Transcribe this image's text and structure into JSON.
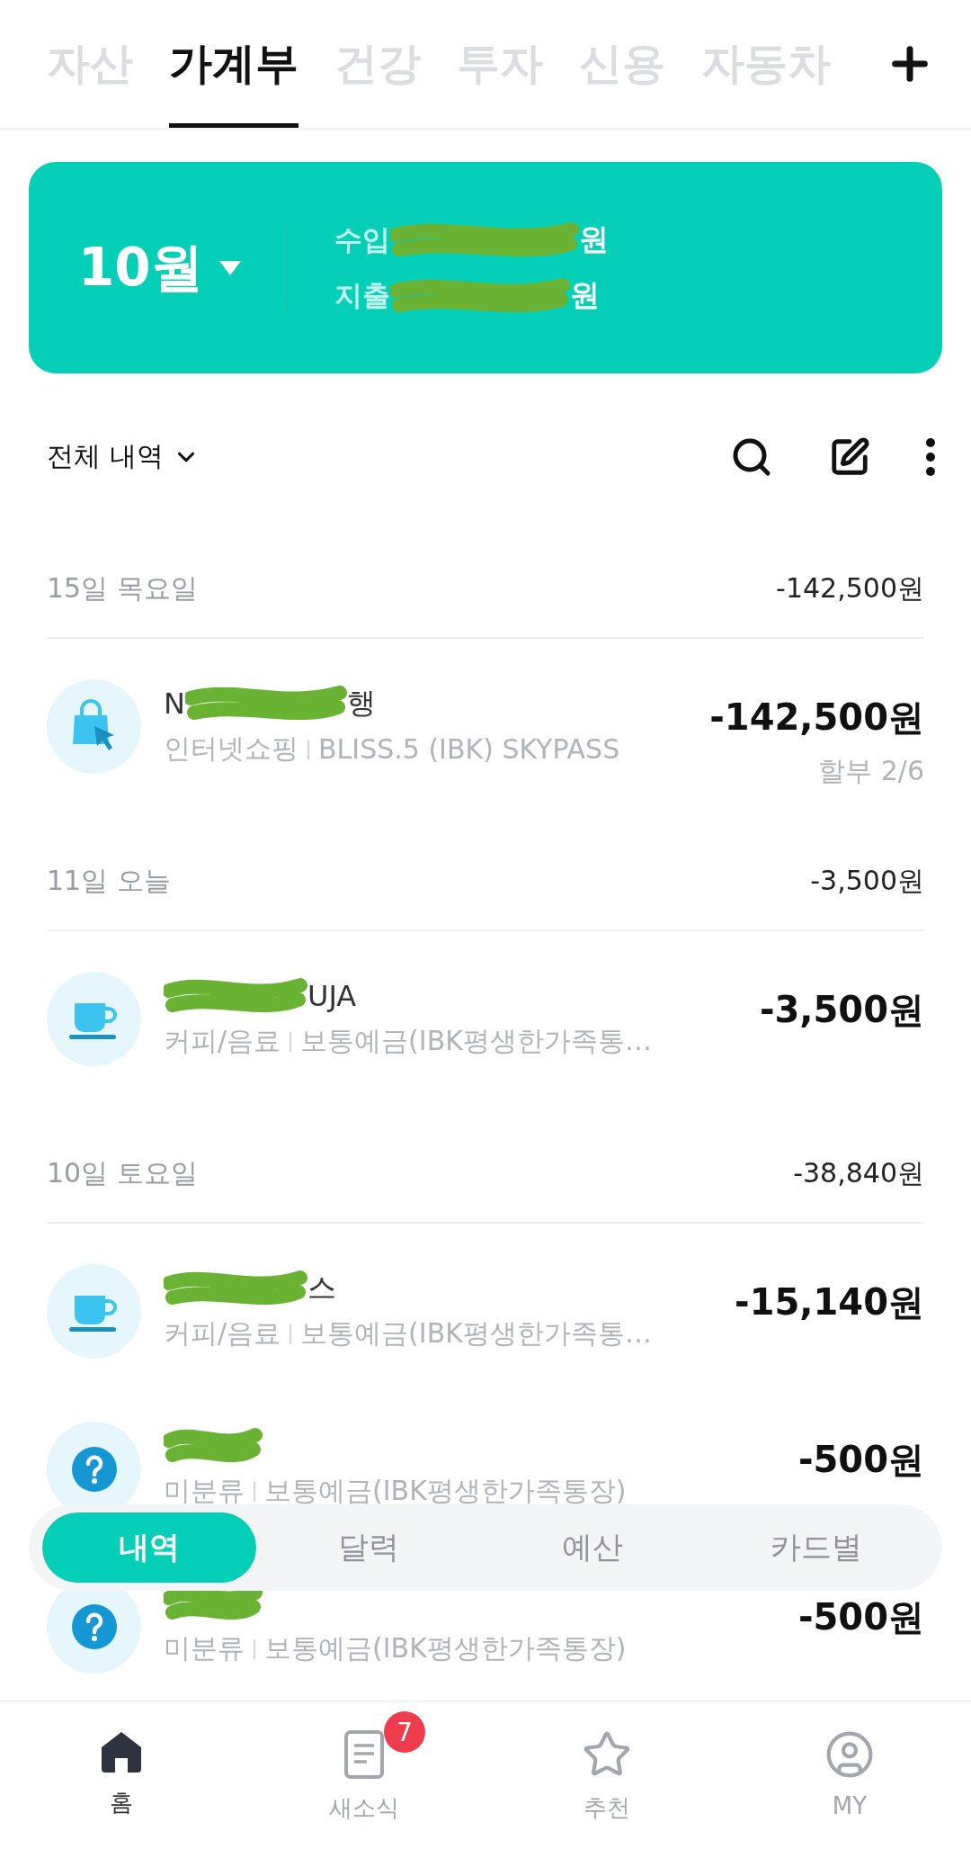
{
  "top_tabs": [
    {
      "label": "자산",
      "selected": false
    },
    {
      "label": "가계부",
      "selected": true
    },
    {
      "label": "건강",
      "selected": false
    },
    {
      "label": "투자",
      "selected": false
    },
    {
      "label": "신용",
      "selected": false
    },
    {
      "label": "자동차",
      "selected": false
    }
  ],
  "summary": {
    "month": "10월",
    "rows": [
      {
        "label": "수입",
        "unit": "원"
      },
      {
        "label": "지출",
        "unit": "원"
      }
    ]
  },
  "filter": {
    "label": "전체 내역"
  },
  "days": [
    {
      "date": "15일 목요일",
      "total": "-142,500원",
      "items": [
        {
          "kind": "shopping",
          "name_before": "N",
          "name_after": "행",
          "category": "인터넷쇼핑",
          "account": "BLISS.5 (IBK) SKYPASS",
          "amount": "-142,500원",
          "note": "할부 2/6"
        }
      ]
    },
    {
      "date": "11일 오늘",
      "total": "-3,500원",
      "items": [
        {
          "kind": "cafe",
          "name_after": "UJA",
          "category": "커피/음료",
          "account": "보통예금(IBK평생한가족통…",
          "amount": "-3,500원"
        }
      ]
    },
    {
      "date": "10일 토요일",
      "total": "-38,840원",
      "items": [
        {
          "kind": "cafe",
          "name_after": "스",
          "category": "커피/음료",
          "account": "보통예금(IBK평생한가족통…",
          "amount": "-15,140원"
        },
        {
          "kind": "unknown",
          "category": "미분류",
          "account": "보통예금(IBK평생한가족통장)",
          "amount": "-500원"
        },
        {
          "kind": "unknown",
          "category": "미분류",
          "account": "보통예금(IBK평생한가족통장)",
          "amount": "-500원"
        }
      ]
    }
  ],
  "view_switch": [
    {
      "label": "내역",
      "selected": true
    },
    {
      "label": "달력",
      "selected": false
    },
    {
      "label": "예산",
      "selected": false
    },
    {
      "label": "카드별",
      "selected": false
    }
  ],
  "bottom_nav": [
    {
      "kind": "home",
      "label": "홈",
      "selected": true
    },
    {
      "kind": "news",
      "label": "새소식",
      "selected": false,
      "badge": "7"
    },
    {
      "kind": "star",
      "label": "추천",
      "selected": false
    },
    {
      "kind": "profile",
      "label": "MY",
      "selected": false
    }
  ]
}
